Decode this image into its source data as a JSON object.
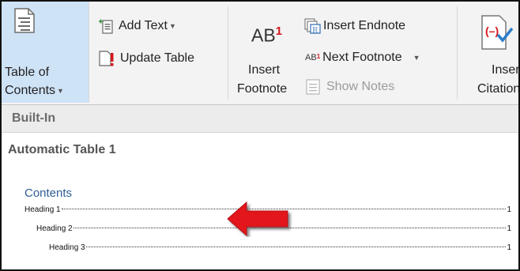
{
  "ribbon": {
    "toc_button": {
      "line1": "Table of",
      "line2": "Contents",
      "icon": "document-lines-icon"
    },
    "add_text": {
      "label": "Add Text",
      "caret": "▾",
      "icon": "add-text-icon"
    },
    "update_table": {
      "label": "Update Table",
      "icon": "update-table-icon"
    },
    "insert_footnote": {
      "superscript": "1",
      "base": "AB",
      "line1": "Insert",
      "line2": "Footnote"
    },
    "insert_endnote": {
      "label": "Insert Endnote",
      "icon": "endnote-icon"
    },
    "next_footnote": {
      "label": "Next Footnote",
      "caret": "▾",
      "icon": "next-footnote-icon",
      "icon_text": "AB",
      "icon_sup": "1"
    },
    "show_notes": {
      "label": "Show Notes",
      "icon": "show-notes-icon",
      "disabled": true
    },
    "insert_citation": {
      "line1": "Insert",
      "line2": "Citation",
      "icon": "citation-icon"
    }
  },
  "gallery": {
    "section_header": "Built-In",
    "item_title": "Automatic Table 1",
    "preview": {
      "contents_heading": "Contents",
      "entries": [
        {
          "name": "Heading 1",
          "page": "1"
        },
        {
          "name": "Heading 2",
          "page": "1"
        },
        {
          "name": "Heading 3",
          "page": "1"
        }
      ]
    }
  },
  "overlay": {
    "arrow_color": "#e3141b",
    "icon": "red-arrow-icon"
  }
}
